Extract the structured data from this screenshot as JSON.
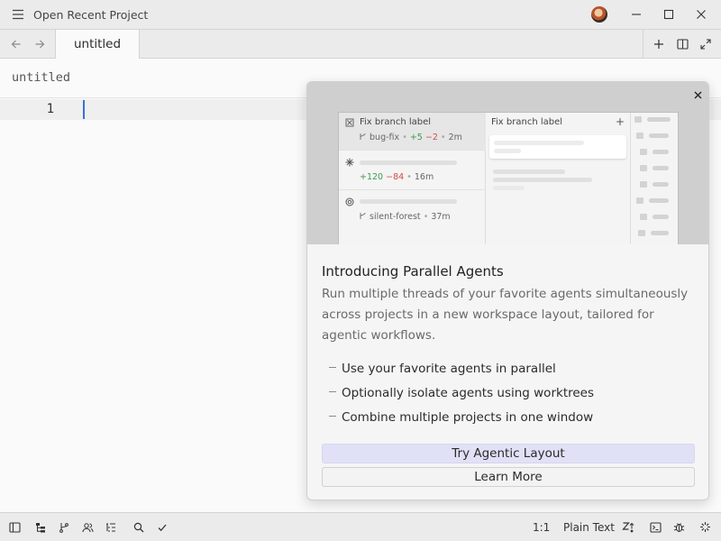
{
  "titlebar": {
    "project_label": "Open Recent Project",
    "icons": [
      "menu-icon",
      "avatar",
      "minimize-icon",
      "maximize-icon",
      "close-icon"
    ]
  },
  "tabbar": {
    "tab_label": "untitled",
    "icons": [
      "back-arrow-icon",
      "forward-arrow-icon",
      "plus-icon",
      "split-pane-icon",
      "fullscreen-icon"
    ]
  },
  "editor": {
    "breadcrumb": "untitled",
    "line_number": "1"
  },
  "popup": {
    "hero": {
      "thread_1": {
        "title": "Fix branch label",
        "branch": "bug-fix",
        "added": "+5",
        "removed": "−2",
        "time": "2m"
      },
      "thread_2": {
        "added": "+120",
        "removed": "−84",
        "time": "16m"
      },
      "thread_3": {
        "branch": "silent-forest",
        "time": "37m"
      },
      "panel_title": "Fix branch label",
      "panel_add": "+"
    },
    "title": "Introducing Parallel Agents",
    "description": "Run multiple threads of your favorite agents simultaneously across projects in a new workspace layout, tailored for agentic workflows.",
    "features": [
      "Use your favorite agents in parallel",
      "Optionally isolate agents using worktrees",
      "Combine multiple projects in one window"
    ],
    "primary_button": "Try Agentic Layout",
    "secondary_button": "Learn More"
  },
  "statusbar": {
    "cursor_position": "1:1",
    "language": "Plain Text",
    "icons": [
      "sidebar-toggle-icon",
      "project-tree-icon",
      "git-branch-icon",
      "collaborators-icon",
      "outline-icon",
      "search-icon",
      "check-icon",
      "zed-predict-icon",
      "terminal-icon",
      "debug-icon",
      "agent-icon"
    ]
  },
  "colors": {
    "accent": "#3a6fd8",
    "added": "#3e9b4f",
    "removed": "#d64a4a",
    "primary_button_bg": "#e0e0f7"
  }
}
